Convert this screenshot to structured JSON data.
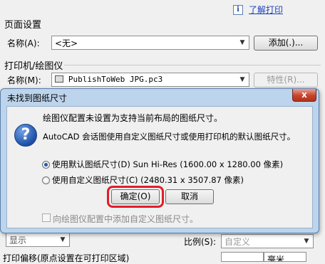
{
  "page_setup": {
    "learn_link": "了解打印",
    "section_title": "页面设置",
    "name_label": "名称(A):",
    "name_value": "<无>",
    "add_button": "添加(.)..."
  },
  "printer": {
    "section_title": "打印机/绘图仪",
    "name_label": "名称(M):",
    "name_value": "PublishToWeb JPG.pc3",
    "properties_button": "特性(R)..."
  },
  "modal": {
    "title": "未找到图纸尺寸",
    "close_label": "x",
    "message_main": "绘图仪配置未设置为支持当前布局的图纸尺寸。",
    "message_detail": "AutoCAD 会话图使用自定义图纸尺寸或使用打印机的默认图纸尺寸。",
    "option_default": "使用默认图纸尺寸(D)  Sun Hi-Res (1600.00 x 1280.00 像素)",
    "option_custom": "使用自定义图纸尺寸(C)   (2480.31 x 3507.87 像素)",
    "ok_button": "确定(O)",
    "cancel_button": "取消",
    "checkbox_label": "向绘图仪配置中添加自定义图纸尺寸。",
    "selected_option": "default"
  },
  "bottom": {
    "display_value": "显示",
    "scale_label": "比例(S):",
    "scale_value": "自定义",
    "offset_title": "打印偏移(原点设置在可打印区域)",
    "units_value": "毫米"
  }
}
